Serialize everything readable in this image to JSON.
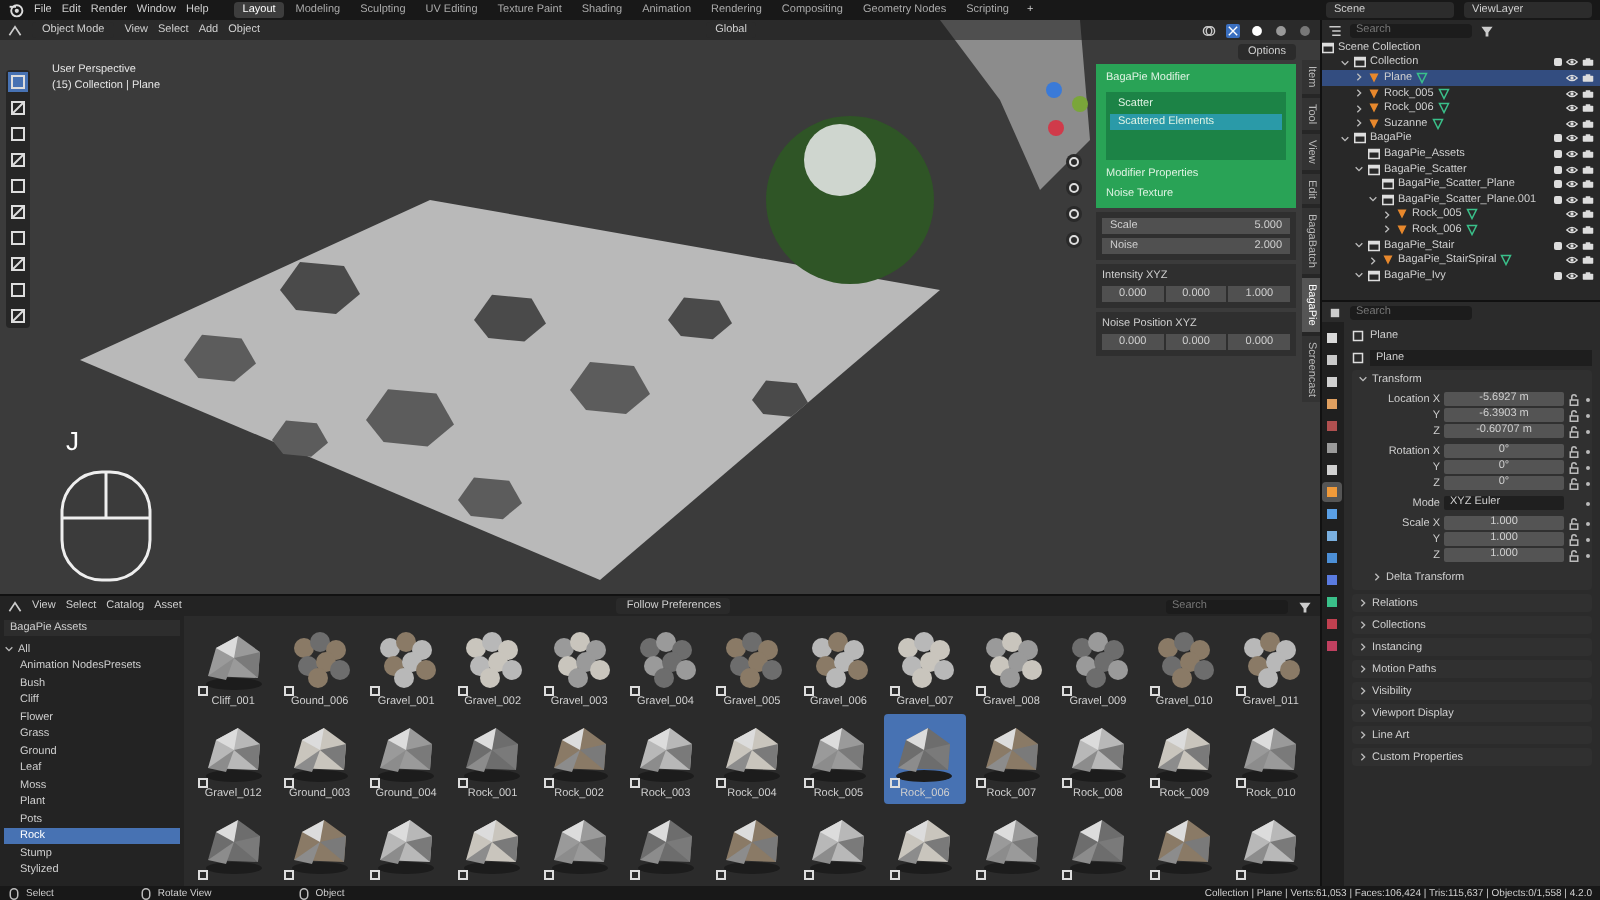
{
  "menu": [
    "File",
    "Edit",
    "Render",
    "Window",
    "Help"
  ],
  "workspaces": [
    {
      "label": "Layout",
      "selected": true
    },
    {
      "label": "Modeling",
      "selected": false
    },
    {
      "label": "Sculpting",
      "selected": false
    },
    {
      "label": "UV Editing",
      "selected": false
    },
    {
      "label": "Texture Paint",
      "selected": false
    },
    {
      "label": "Shading",
      "selected": false
    },
    {
      "label": "Animation",
      "selected": false
    },
    {
      "label": "Rendering",
      "selected": false
    },
    {
      "label": "Compositing",
      "selected": false
    },
    {
      "label": "Geometry Nodes",
      "selected": false
    },
    {
      "label": "Scripting",
      "selected": false
    }
  ],
  "add_workspace": "+",
  "scene": "Scene",
  "view_layer": "ViewLayer",
  "viewport": {
    "mode": "Object Mode",
    "menu": [
      "View",
      "Select",
      "Add",
      "Object"
    ],
    "orientation": "Global",
    "options": "Options",
    "view_name": "User Perspective",
    "view_info": "(15) Collection | Plane",
    "key": "J",
    "bagapie": {
      "title": "BagaPie Modifier",
      "items": [
        {
          "label": "Scatter",
          "selected": false
        },
        {
          "label": "Scattered Elements",
          "selected": true
        }
      ],
      "section": "Modifier Properties",
      "subsection": "Noise Texture"
    },
    "noise": [
      {
        "label": "Scale",
        "value": "5.000"
      },
      {
        "label": "Noise",
        "value": "2.000"
      }
    ],
    "vectors": [
      {
        "label": "Intensity XYZ",
        "values": [
          "0.000",
          "0.000",
          "1.000"
        ]
      },
      {
        "label": "Noise Position XYZ",
        "values": [
          "0.000",
          "0.000",
          "0.000"
        ]
      }
    ],
    "side_tabs": [
      {
        "label": "Item",
        "selected": false
      },
      {
        "label": "Tool",
        "selected": false
      },
      {
        "label": "View",
        "selected": false
      },
      {
        "label": "Edit",
        "selected": false
      },
      {
        "label": "BagaBatch",
        "selected": false
      },
      {
        "label": "BagaPie",
        "selected": true
      },
      {
        "label": "Screencast",
        "selected": false
      }
    ]
  },
  "outliner": {
    "search_placeholder": "Search",
    "root": "Scene Collection",
    "tree": [
      {
        "name": "Collection",
        "kind": "collection",
        "expanded": true,
        "selected": false,
        "children": [
          {
            "name": "Plane",
            "kind": "object",
            "expanded": false,
            "selected": true
          },
          {
            "name": "Rock_005",
            "kind": "object",
            "expanded": false,
            "selected": false
          },
          {
            "name": "Rock_006",
            "kind": "object",
            "expanded": false,
            "selected": false
          },
          {
            "name": "Suzanne",
            "kind": "object",
            "expanded": false,
            "selected": false
          }
        ]
      },
      {
        "name": "BagaPie",
        "kind": "collection",
        "expanded": true,
        "selected": false,
        "children": [
          {
            "name": "BagaPie_Assets",
            "kind": "collection",
            "selected": false
          },
          {
            "name": "BagaPie_Scatter",
            "kind": "collection",
            "expanded": true,
            "selected": false,
            "children": [
              {
                "name": "BagaPie_Scatter_Plane",
                "kind": "collection",
                "selected": false
              },
              {
                "name": "BagaPie_Scatter_Plane.001",
                "kind": "collection",
                "expanded": true,
                "selected": false,
                "children": [
                  {
                    "name": "Rock_005",
                    "kind": "object",
                    "expanded": false,
                    "selected": false
                  },
                  {
                    "name": "Rock_006",
                    "kind": "object",
                    "expanded": false,
                    "selected": false
                  }
                ]
              }
            ]
          },
          {
            "name": "BagaPie_Stair",
            "kind": "collection",
            "expanded": true,
            "selected": false,
            "children": [
              {
                "name": "BagaPie_StairSpiral",
                "kind": "object",
                "expanded": false,
                "selected": false
              }
            ]
          },
          {
            "name": "BagaPie_Ivy",
            "kind": "collection",
            "expanded": true,
            "selected": false
          }
        ]
      }
    ]
  },
  "properties": {
    "search_placeholder": "Search",
    "object_name": "Plane",
    "data_name": "Plane",
    "tabs": [
      {
        "selected": false
      },
      {
        "selected": false
      },
      {
        "selected": false
      },
      {
        "selected": false
      },
      {
        "selected": false
      },
      {
        "selected": false
      },
      {
        "selected": false
      },
      {
        "selected": true
      },
      {
        "selected": false
      },
      {
        "selected": false
      },
      {
        "selected": false
      },
      {
        "selected": false
      },
      {
        "selected": false
      },
      {
        "selected": false
      },
      {
        "selected": false
      }
    ],
    "transform": {
      "title": "Transform",
      "expanded": true,
      "groups": [
        [
          {
            "label": "Location X",
            "value": "-5.6927 m",
            "kind": "field"
          },
          {
            "label": "Y",
            "value": "-6.3903 m",
            "kind": "field"
          },
          {
            "label": "Z",
            "value": "-0.60707 m",
            "kind": "field"
          }
        ],
        [
          {
            "label": "Rotation X",
            "value": "0°",
            "kind": "field"
          },
          {
            "label": "Y",
            "value": "0°",
            "kind": "field"
          },
          {
            "label": "Z",
            "value": "0°",
            "kind": "field"
          }
        ],
        [
          {
            "label": "Mode",
            "value": "XYZ Euler",
            "kind": "dropdown"
          }
        ],
        [
          {
            "label": "Scale X",
            "value": "1.000",
            "kind": "field"
          },
          {
            "label": "Y",
            "value": "1.000",
            "kind": "field"
          },
          {
            "label": "Z",
            "value": "1.000",
            "kind": "field"
          }
        ]
      ],
      "subpanel": {
        "title": "Delta Transform",
        "expanded": false
      }
    },
    "panels": [
      {
        "title": "Relations",
        "expanded": false
      },
      {
        "title": "Collections",
        "expanded": false
      },
      {
        "title": "Instancing",
        "expanded": false
      },
      {
        "title": "Motion Paths",
        "expanded": false
      },
      {
        "title": "Visibility",
        "expanded": false
      },
      {
        "title": "Viewport Display",
        "expanded": false
      },
      {
        "title": "Line Art",
        "expanded": false
      },
      {
        "title": "Custom Properties",
        "expanded": false
      }
    ]
  },
  "assets": {
    "menu": [
      "View",
      "Select",
      "Catalog",
      "Asset"
    ],
    "display": "Follow Preferences",
    "search_placeholder": "Search",
    "library": "BagaPie Assets",
    "catalog_root": {
      "label": "All",
      "expanded": true
    },
    "catalogs": [
      {
        "label": "Animation NodesPresets",
        "selected": false
      },
      {
        "label": "Bush",
        "selected": false
      },
      {
        "label": "Cliff",
        "selected": false
      },
      {
        "label": "Flower",
        "selected": false
      },
      {
        "label": "Grass",
        "selected": false
      },
      {
        "label": "Ground",
        "selected": false
      },
      {
        "label": "Leaf",
        "selected": false
      },
      {
        "label": "Moss",
        "selected": false
      },
      {
        "label": "Plant",
        "selected": false
      },
      {
        "label": "Pots",
        "selected": false
      },
      {
        "label": "Rock",
        "selected": true
      },
      {
        "label": "Stump",
        "selected": false
      },
      {
        "label": "Stylized",
        "selected": false
      }
    ],
    "items": [
      {
        "name": "Cliff_001",
        "kind": "picture",
        "selected": false
      },
      {
        "name": "Gound_006",
        "kind": "picture",
        "selected": false
      },
      {
        "name": "Gravel_001",
        "kind": "picture",
        "selected": false
      },
      {
        "name": "Gravel_002",
        "kind": "picture",
        "selected": false
      },
      {
        "name": "Gravel_003",
        "kind": "picture",
        "selected": false
      },
      {
        "name": "Gravel_004",
        "kind": "picture",
        "selected": false
      },
      {
        "name": "Gravel_005",
        "kind": "picture",
        "selected": false
      },
      {
        "name": "Gravel_006",
        "kind": "picture",
        "selected": false
      },
      {
        "name": "Gravel_007",
        "kind": "picture",
        "selected": false
      },
      {
        "name": "Gravel_008",
        "kind": "picture",
        "selected": false
      },
      {
        "name": "Gravel_009",
        "kind": "picture",
        "selected": false
      },
      {
        "name": "Gravel_010",
        "kind": "picture",
        "selected": false
      },
      {
        "name": "Gravel_011",
        "kind": "picture",
        "selected": false
      },
      {
        "name": "Gravel_012",
        "kind": "picture",
        "selected": false
      },
      {
        "name": "Ground_003",
        "kind": "picture",
        "selected": false
      },
      {
        "name": "Ground_004",
        "kind": "picture",
        "selected": false
      },
      {
        "name": "Rock_001",
        "kind": "picture",
        "selected": false
      },
      {
        "name": "Rock_002",
        "kind": "picture",
        "selected": false
      },
      {
        "name": "Rock_003",
        "kind": "picture",
        "selected": false
      },
      {
        "name": "Rock_004",
        "kind": "picture",
        "selected": false
      },
      {
        "name": "Rock_005",
        "kind": "picture",
        "selected": false
      },
      {
        "name": "Rock_006",
        "kind": "picture",
        "selected": true
      },
      {
        "name": "Rock_007",
        "kind": "picture",
        "selected": false
      },
      {
        "name": "Rock_008",
        "kind": "picture",
        "selected": false
      },
      {
        "name": "Rock_009",
        "kind": "picture",
        "selected": false
      },
      {
        "name": "Rock_010",
        "kind": "picture",
        "selected": false
      },
      {
        "kind": "picture",
        "selected": false
      },
      {
        "kind": "picture",
        "selected": false
      },
      {
        "kind": "picture",
        "selected": false
      },
      {
        "kind": "picture",
        "selected": false
      },
      {
        "kind": "picture",
        "selected": false
      },
      {
        "kind": "picture",
        "selected": false
      },
      {
        "kind": "picture",
        "selected": false
      },
      {
        "kind": "picture",
        "selected": false
      },
      {
        "kind": "picture",
        "selected": false
      },
      {
        "kind": "picture",
        "selected": false
      },
      {
        "kind": "picture",
        "selected": false
      },
      {
        "kind": "picture",
        "selected": false
      },
      {
        "kind": "picture",
        "selected": false
      }
    ]
  },
  "status_bar": {
    "hints": [
      "Select",
      "Rotate View",
      "Object"
    ],
    "stats": "Collection | Plane | Verts:61,053 | Faces:106,424 | Tris:115,637 | Objects:0/1,558 | 4.2.0"
  }
}
